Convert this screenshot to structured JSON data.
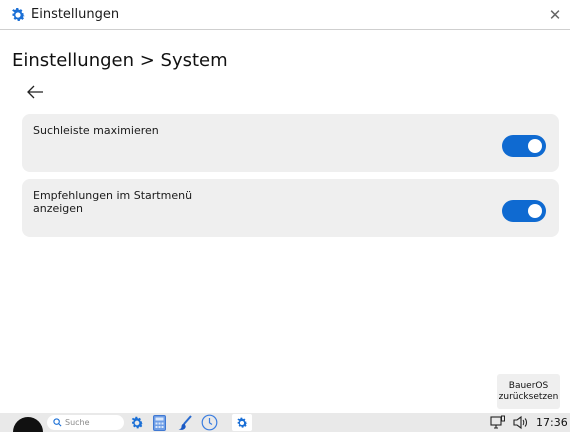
{
  "window": {
    "title": "Einstellungen",
    "close_icon": "close-icon"
  },
  "page": {
    "breadcrumb": "Einstellungen > System",
    "back_icon": "arrow-left-icon"
  },
  "settings": [
    {
      "label": "Suchleiste maximieren",
      "enabled": true
    },
    {
      "label": "Empfehlungen im Startmenü anzeigen",
      "enabled": true
    }
  ],
  "reset_button": {
    "label": "BauerOS zurücksetzen"
  },
  "taskbar": {
    "search_placeholder": "Suche",
    "pinned": [
      "gear-icon",
      "calculator-icon",
      "paint-icon",
      "clock-icon",
      "gear-icon"
    ],
    "clock": "17:36"
  },
  "colors": {
    "accent": "#0f6ad1",
    "card": "#efefef",
    "taskbar": "#e9e9e9"
  }
}
